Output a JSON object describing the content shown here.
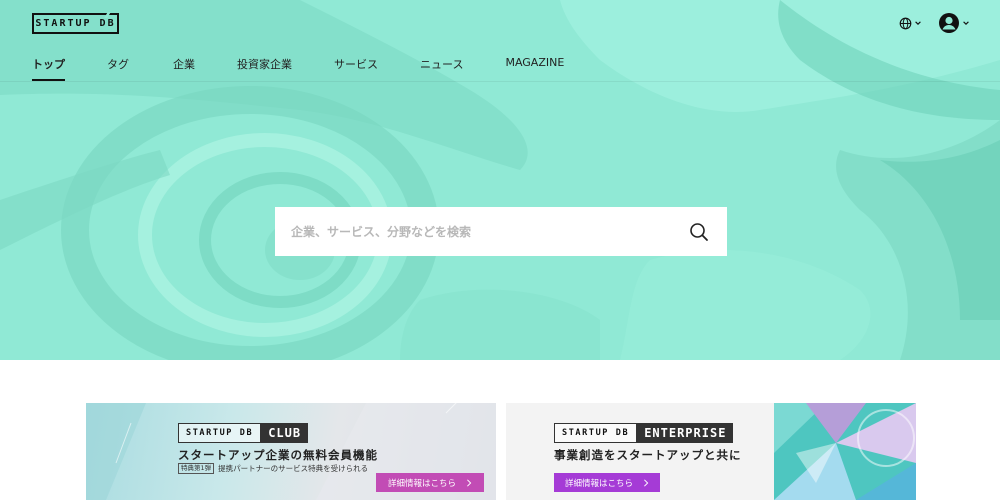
{
  "header": {
    "logo": "STARTUP DB",
    "nav": [
      {
        "label": "トップ"
      },
      {
        "label": "タグ"
      },
      {
        "label": "企業"
      },
      {
        "label": "投資家企業"
      },
      {
        "label": "サービス"
      },
      {
        "label": "ニュース"
      },
      {
        "label": "MAGAZINE"
      }
    ],
    "active_index": 0,
    "icons": [
      "globe-icon",
      "chevron-down-icon",
      "user-avatar-icon",
      "chevron-down-icon"
    ]
  },
  "hero": {
    "background_color": "#8fe8d4",
    "search": {
      "placeholder": "企業、サービス、分野などを検索",
      "value": "",
      "icon": "search-icon"
    }
  },
  "banners": {
    "club": {
      "brand": "STARTUP DB",
      "brand_sub": "CLUB",
      "headline": "スタートアップ企業の無料会員機能",
      "badge": "特典第1弾",
      "subtext": "提携パートナーのサービス特典を受けられる",
      "cta": "詳細情報はこちら",
      "cta_color": "#c24cb5"
    },
    "enterprise": {
      "brand": "STARTUP DB",
      "brand_sub": "ENTERPRISE",
      "headline": "事業創造をスタートアップと共に",
      "cta": "詳細情報はこちら",
      "cta_color": "#a53bd6"
    }
  }
}
